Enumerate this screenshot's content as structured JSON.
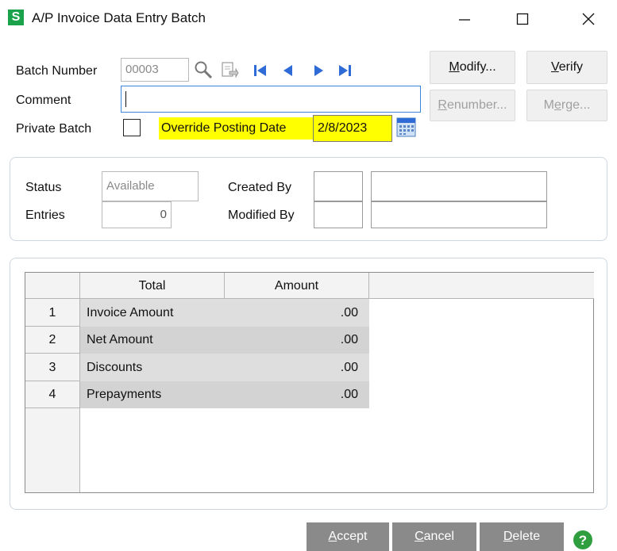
{
  "window": {
    "app_icon_letter": "S",
    "title": "A/P Invoice Data Entry Batch"
  },
  "header": {
    "batch_number_label": "Batch Number",
    "batch_number_value": "00003",
    "comment_label": "Comment",
    "comment_value": "",
    "private_batch_label": "Private Batch",
    "private_batch_checked": false,
    "override_label": "Override Posting Date",
    "override_value": "2/8/2023",
    "highlight_color": "#ffff00"
  },
  "buttons": {
    "modify_prefix": "",
    "modify_ul": "M",
    "modify_rest": "odify...",
    "verify_prefix": "",
    "verify_ul": "V",
    "verify_rest": "erify",
    "renumber_prefix": "",
    "renumber_ul": "R",
    "renumber_rest": "enumber...",
    "merge_prefix": "M",
    "merge_ul": "e",
    "merge_rest": "rge..."
  },
  "info": {
    "status_label": "Status",
    "status_value": "Available",
    "entries_label": "Entries",
    "entries_value": "0",
    "created_by_label": "Created By",
    "modified_by_label": "Modified By"
  },
  "grid": {
    "col_total": "Total",
    "col_amount": "Amount",
    "rows": [
      {
        "num": "1",
        "label": "Invoice Amount",
        "value": ".00"
      },
      {
        "num": "2",
        "label": "Net Amount",
        "value": ".00"
      },
      {
        "num": "3",
        "label": "Discounts",
        "value": ".00"
      },
      {
        "num": "4",
        "label": "Prepayments",
        "value": ".00"
      }
    ]
  },
  "footer": {
    "accept_ul": "A",
    "accept_rest": "ccept",
    "cancel_ul": "C",
    "cancel_rest": "ancel",
    "delete_ul": "D",
    "delete_rest": "elete",
    "button_color": "#8a8a8a",
    "help_color": "#2e9e3e"
  }
}
